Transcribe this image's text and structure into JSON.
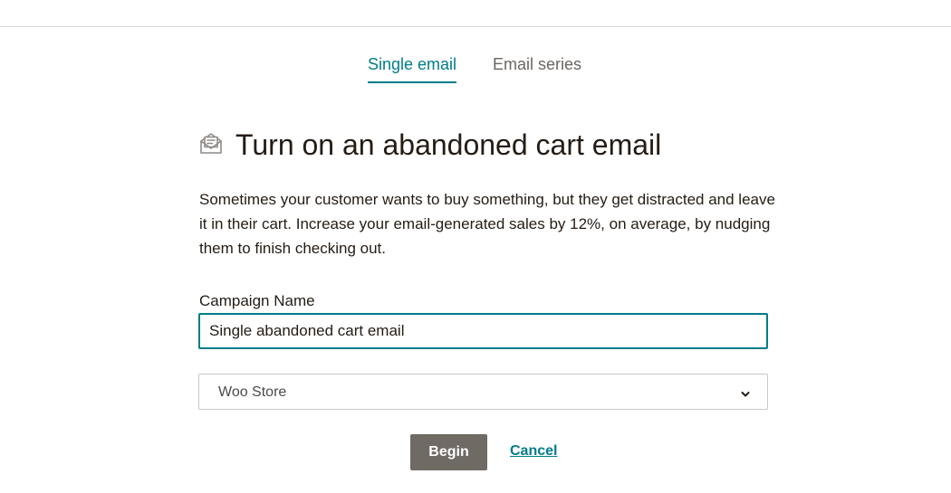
{
  "tabs": [
    {
      "label": "Single email",
      "active": true
    },
    {
      "label": "Email series",
      "active": false
    }
  ],
  "heading": {
    "icon": "envelope-letter-icon",
    "title": "Turn on an abandoned cart email"
  },
  "description": "Sometimes your customer wants to buy something, but they get distracted and leave it in their cart. Increase your email-generated sales by 12%, on average, by nudging them to finish checking out.",
  "form": {
    "campaign_name_label": "Campaign Name",
    "campaign_name_value": "Single abandoned cart email",
    "store_select": {
      "selected": "Woo Store",
      "icon": "chevron-down-icon"
    }
  },
  "actions": {
    "begin_label": "Begin",
    "cancel_label": "Cancel"
  },
  "colors": {
    "accent": "#007c89",
    "primary_button": "#706a65",
    "text": "#241c15"
  }
}
